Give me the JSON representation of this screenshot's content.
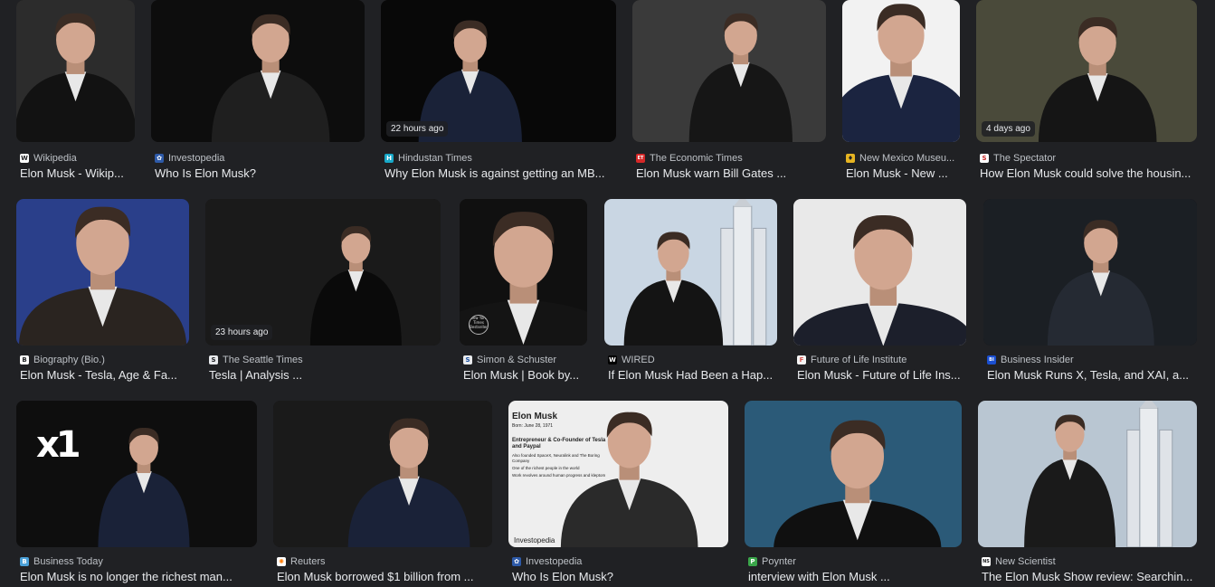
{
  "results": [
    {
      "source": "Wikipedia",
      "title": "Elon Musk - Wikip...",
      "badge": "",
      "icon": "wikipedia-favicon-icon",
      "icon_letter": "W",
      "icon_bg": "#ffffff",
      "icon_fg": "#202124",
      "bg": "#2c2c2c",
      "suit": "#121212"
    },
    {
      "source": "Investopedia",
      "title": "Who Is Elon Musk?",
      "badge": "",
      "icon": "investopedia-favicon-icon",
      "icon_letter": "✿",
      "icon_bg": "#2e5aa8",
      "icon_fg": "#ffffff",
      "bg": "#0d0d0d",
      "suit": "#1f1f1f"
    },
    {
      "source": "Hindustan Times",
      "title": "Why Elon Musk is against getting an MB...",
      "badge": "22 hours ago",
      "icon": "hindustan-times-favicon-icon",
      "icon_letter": "H",
      "icon_bg": "#18a9c9",
      "icon_fg": "#ffffff",
      "bg": "#080808",
      "suit": "#1a2238"
    },
    {
      "source": "The Economic Times",
      "title": "Elon Musk warn Bill Gates ...",
      "badge": "",
      "icon": "economic-times-favicon-icon",
      "icon_letter": "ET",
      "icon_bg": "#d62828",
      "icon_fg": "#ffffff",
      "bg": "#3a3a3a",
      "suit": "#161616"
    },
    {
      "source": "New Mexico Museu...",
      "title": "Elon Musk - New ...",
      "badge": "",
      "icon": "new-mexico-museum-favicon-icon",
      "icon_letter": "♦",
      "icon_bg": "#e6b422",
      "icon_fg": "#202124",
      "bg": "#f2f2f2",
      "suit": "#1b2440"
    },
    {
      "source": "The Spectator",
      "title": "How Elon Musk could solve the housin...",
      "badge": "4 days ago",
      "icon": "spectator-favicon-icon",
      "icon_letter": "S",
      "icon_bg": "#ffffff",
      "icon_fg": "#c62828",
      "bg": "#4a4a3a",
      "suit": "#151515"
    },
    {
      "source": "Biography (Bio.)",
      "title": "Elon Musk - Tesla, Age & Fa...",
      "badge": "",
      "icon": "biography-favicon-icon",
      "icon_letter": "B",
      "icon_bg": "#ffffff",
      "icon_fg": "#202124",
      "bg": "#2a3f8a",
      "suit": "#2a2420"
    },
    {
      "source": "The Seattle Times",
      "title": "Tesla | Analysis ...",
      "badge": "23 hours ago",
      "icon": "seattle-times-favicon-icon",
      "icon_letter": "S",
      "icon_bg": "#e8eaed",
      "icon_fg": "#202124",
      "bg": "#1a1a1a",
      "suit": "#0a0a0a"
    },
    {
      "source": "Simon & Schuster",
      "title": "Elon Musk | Book by...",
      "badge": "",
      "icon": "simon-schuster-favicon-icon",
      "icon_letter": "S",
      "icon_bg": "#e8eaed",
      "icon_fg": "#1a4fa0",
      "bg": "#101010",
      "suit": "#141414"
    },
    {
      "source": "WIRED",
      "title": "If Elon Musk Had Been a Hap...",
      "badge": "",
      "icon": "wired-favicon-icon",
      "icon_letter": "W",
      "icon_bg": "#000000",
      "icon_fg": "#ffffff",
      "bg": "#c9d6e3",
      "suit": "#141414"
    },
    {
      "source": "Future of Life Institute",
      "title": "Elon Musk - Future of Life Ins...",
      "badge": "",
      "icon": "future-of-life-favicon-icon",
      "icon_letter": "F",
      "icon_bg": "#f5f5f5",
      "icon_fg": "#d9534f",
      "bg": "#e9e9e9",
      "suit": "#1c1f2b"
    },
    {
      "source": "Business Insider",
      "title": "Elon Musk Runs X, Tesla, and XAI, a...",
      "badge": "",
      "icon": "business-insider-favicon-icon",
      "icon_letter": "BI",
      "icon_bg": "#1a4fd1",
      "icon_fg": "#ffffff",
      "bg": "#1b1f24",
      "suit": "#252a33"
    },
    {
      "source": "Business Today",
      "title": "Elon Musk is no longer the richest man...",
      "badge": "",
      "icon": "business-today-favicon-icon",
      "icon_letter": "B",
      "icon_bg": "#4aa0d8",
      "icon_fg": "#ffffff",
      "bg": "#0e0e0e",
      "suit": "#1a2238"
    },
    {
      "source": "Reuters",
      "title": "Elon Musk borrowed $1 billion from ...",
      "badge": "",
      "icon": "reuters-favicon-icon",
      "icon_letter": "✺",
      "icon_bg": "#ffffff",
      "icon_fg": "#ff7a00",
      "bg": "#1a1a1a",
      "suit": "#1a2238"
    },
    {
      "source": "Investopedia",
      "title": "Who Is Elon Musk?",
      "badge": "",
      "icon": "investopedia-favicon-icon",
      "icon_letter": "✿",
      "icon_bg": "#2e5aa8",
      "icon_fg": "#ffffff",
      "bg": "#eeeeee",
      "suit": "#2a2a2a"
    },
    {
      "source": "Poynter",
      "title": "interview with Elon Musk ...",
      "badge": "",
      "icon": "poynter-favicon-icon",
      "icon_letter": "P",
      "icon_bg": "#3aa64a",
      "icon_fg": "#ffffff",
      "bg": "#2b5a78",
      "suit": "#101010"
    },
    {
      "source": "New Scientist",
      "title": "The Elon Musk Show review: Searchin...",
      "badge": "",
      "icon": "new-scientist-favicon-icon",
      "icon_letter": "NS",
      "icon_bg": "#ffffff",
      "icon_fg": "#202124",
      "bg": "#b9c6d2",
      "suit": "#1a1a1a"
    }
  ],
  "illustration_card": {
    "heading": "Elon Musk",
    "born": "Born: June 28, 1971",
    "role": "Entrepreneur & Co-Founder of Tesla and Paypal",
    "bullets": [
      "Also founded SpaceX, Neuralink and The Boring Company",
      "One of the richest people in the world",
      "Work revolves around human progress and kleptom"
    ],
    "logo": "Investopedia"
  },
  "xai_logo": "x1",
  "book_seal": "New York Times Bestseller"
}
